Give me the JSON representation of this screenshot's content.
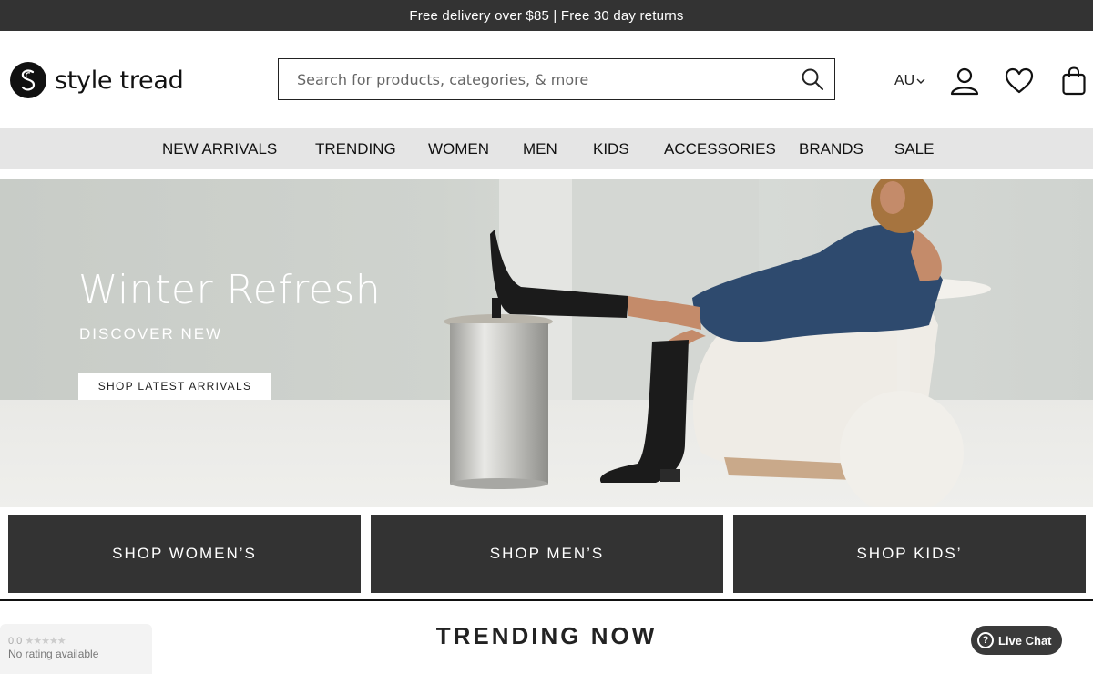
{
  "promo": {
    "text": "Free delivery over $85 | Free 30 day returns"
  },
  "header": {
    "logo_text": "style tread",
    "search_placeholder": "Search for products, categories, & more",
    "region": "AU"
  },
  "nav": {
    "items": [
      {
        "label": "NEW ARRIVALS"
      },
      {
        "label": "TRENDING"
      },
      {
        "label": "WOMEN"
      },
      {
        "label": "MEN"
      },
      {
        "label": "KIDS"
      },
      {
        "label": "ACCESSORIES"
      },
      {
        "label": "BRANDS"
      },
      {
        "label": "SALE"
      }
    ]
  },
  "hero": {
    "title": "Winter Refresh",
    "subtitle": "DISCOVER NEW",
    "cta": "SHOP LATEST ARRIVALS"
  },
  "shop_tiles": [
    {
      "label": "SHOP WOMEN’S"
    },
    {
      "label": "SHOP MEN’S"
    },
    {
      "label": "SHOP KIDS’"
    }
  ],
  "section": {
    "title": "TRENDING NOW"
  },
  "rating_widget": {
    "score": "0.0",
    "stars": "★★★★★",
    "text": "No rating available"
  },
  "chat": {
    "label": "Live Chat"
  },
  "colors": {
    "dark": "#333333",
    "nav_bg": "#e5e5e5",
    "white": "#ffffff"
  },
  "icons": [
    "logo-s-icon",
    "search-icon",
    "chevron-down-icon",
    "account-icon",
    "heart-icon",
    "bag-icon",
    "help-icon"
  ]
}
